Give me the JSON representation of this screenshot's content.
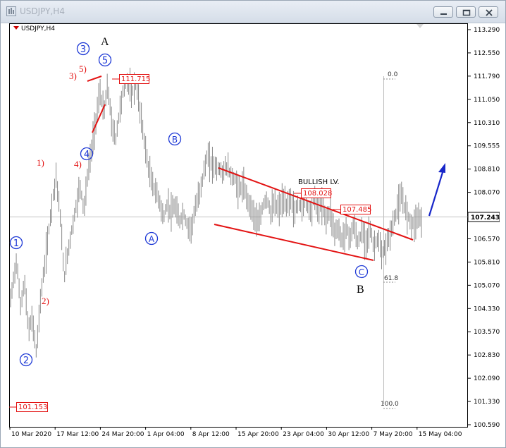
{
  "window": {
    "title": "USDJPY,H4"
  },
  "chart_data": {
    "type": "candlestick",
    "symbol_label": "USDJPY,H4",
    "current_price": "107.243",
    "y_ticks": [
      "113.290",
      "112.550",
      "111.790",
      "111.050",
      "110.310",
      "109.555",
      "108.810",
      "108.070",
      "107.320",
      "106.570",
      "105.810",
      "105.070",
      "104.330",
      "103.570",
      "102.830",
      "102.090",
      "101.330",
      "100.590"
    ],
    "ylim": [
      100.59,
      113.29
    ],
    "x_ticks": [
      "10 Mar 2020",
      "17 Mar 12:00",
      "24 Mar 20:00",
      "1 Apr 04:00",
      "8 Apr 12:00",
      "15 Apr 20:00",
      "23 Apr 04:00",
      "30 Apr 12:00",
      "7 May 20:00",
      "15 May 04:00"
    ],
    "price_marks": [
      "111.715",
      "108.028",
      "107.485",
      "101.153"
    ],
    "fib_levels": [
      "0.0",
      "61.8",
      "100.0"
    ],
    "annotations": {
      "wave_labels": [
        "A",
        "B"
      ],
      "bullish_label": "BULLISH LV.",
      "circled": [
        "1",
        "2",
        "3",
        "4",
        "5",
        "A",
        "B",
        "C"
      ],
      "minor": [
        "1)",
        "2)",
        "3)",
        "4)",
        "5)"
      ]
    },
    "price_path": [
      {
        "t": 0,
        "p": 104.6
      },
      {
        "t": 3,
        "p": 105.9
      },
      {
        "t": 5,
        "p": 104.4
      },
      {
        "t": 7,
        "p": 105.2
      },
      {
        "t": 9,
        "p": 103.6
      },
      {
        "t": 11,
        "p": 104.0
      },
      {
        "t": 13,
        "p": 102.9
      },
      {
        "t": 15,
        "p": 104.6
      },
      {
        "t": 17,
        "p": 105.6
      },
      {
        "t": 19,
        "p": 106.7
      },
      {
        "t": 21,
        "p": 107.8
      },
      {
        "t": 23,
        "p": 108.6
      },
      {
        "t": 25,
        "p": 107.3
      },
      {
        "t": 27,
        "p": 105.3
      },
      {
        "t": 29,
        "p": 106.2
      },
      {
        "t": 31,
        "p": 106.9
      },
      {
        "t": 33,
        "p": 107.6
      },
      {
        "t": 35,
        "p": 108.3
      },
      {
        "t": 37,
        "p": 107.5
      },
      {
        "t": 39,
        "p": 108.7
      },
      {
        "t": 41,
        "p": 109.5
      },
      {
        "t": 43,
        "p": 110.4
      },
      {
        "t": 45,
        "p": 111.3
      },
      {
        "t": 47,
        "p": 110.6
      },
      {
        "t": 49,
        "p": 111.5
      },
      {
        "t": 51,
        "p": 110.2
      },
      {
        "t": 53,
        "p": 109.8
      },
      {
        "t": 55,
        "p": 110.7
      },
      {
        "t": 57,
        "p": 111.4
      },
      {
        "t": 59,
        "p": 111.7
      },
      {
        "t": 61,
        "p": 111.2
      },
      {
        "t": 63,
        "p": 111.6
      },
      {
        "t": 65,
        "p": 110.8
      },
      {
        "t": 67,
        "p": 109.9
      },
      {
        "t": 69,
        "p": 109.0
      },
      {
        "t": 71,
        "p": 108.4
      },
      {
        "t": 73,
        "p": 108.1
      },
      {
        "t": 75,
        "p": 107.8
      },
      {
        "t": 77,
        "p": 107.2
      },
      {
        "t": 79,
        "p": 107.7
      },
      {
        "t": 81,
        "p": 107.4
      },
      {
        "t": 83,
        "p": 107.6
      },
      {
        "t": 85,
        "p": 107.1
      },
      {
        "t": 87,
        "p": 107.4
      },
      {
        "t": 89,
        "p": 107.0
      },
      {
        "t": 91,
        "p": 106.9
      },
      {
        "t": 93,
        "p": 107.5
      },
      {
        "t": 95,
        "p": 108.0
      },
      {
        "t": 97,
        "p": 108.6
      },
      {
        "t": 99,
        "p": 109.2
      },
      {
        "t": 101,
        "p": 109.0
      },
      {
        "t": 103,
        "p": 108.9
      },
      {
        "t": 105,
        "p": 108.8
      },
      {
        "t": 107,
        "p": 108.7
      },
      {
        "t": 109,
        "p": 108.9
      },
      {
        "t": 111,
        "p": 108.6
      },
      {
        "t": 113,
        "p": 108.5
      },
      {
        "t": 115,
        "p": 108.1
      },
      {
        "t": 117,
        "p": 108.3
      },
      {
        "t": 119,
        "p": 107.9
      },
      {
        "t": 121,
        "p": 107.6
      },
      {
        "t": 123,
        "p": 107.3
      },
      {
        "t": 125,
        "p": 107.0
      },
      {
        "t": 127,
        "p": 107.6
      },
      {
        "t": 129,
        "p": 107.9
      },
      {
        "t": 131,
        "p": 107.4
      },
      {
        "t": 133,
        "p": 107.7
      },
      {
        "t": 135,
        "p": 107.5
      },
      {
        "t": 137,
        "p": 107.8
      },
      {
        "t": 139,
        "p": 107.6
      },
      {
        "t": 141,
        "p": 107.9
      },
      {
        "t": 143,
        "p": 107.4
      },
      {
        "t": 145,
        "p": 107.7
      },
      {
        "t": 147,
        "p": 107.6
      },
      {
        "t": 149,
        "p": 107.8
      },
      {
        "t": 151,
        "p": 107.4
      },
      {
        "t": 153,
        "p": 107.9
      },
      {
        "t": 155,
        "p": 107.5
      },
      {
        "t": 157,
        "p": 107.7
      },
      {
        "t": 159,
        "p": 107.2
      },
      {
        "t": 161,
        "p": 107.5
      },
      {
        "t": 163,
        "p": 106.8
      },
      {
        "t": 165,
        "p": 106.9
      },
      {
        "t": 167,
        "p": 106.5
      },
      {
        "t": 169,
        "p": 106.9
      },
      {
        "t": 171,
        "p": 106.6
      },
      {
        "t": 173,
        "p": 107.0
      },
      {
        "t": 175,
        "p": 106.4
      },
      {
        "t": 177,
        "p": 106.8
      },
      {
        "t": 179,
        "p": 106.5
      },
      {
        "t": 181,
        "p": 106.9
      },
      {
        "t": 183,
        "p": 106.3
      },
      {
        "t": 185,
        "p": 106.6
      },
      {
        "t": 187,
        "p": 106.0
      },
      {
        "t": 189,
        "p": 106.3
      },
      {
        "t": 191,
        "p": 106.7
      },
      {
        "t": 193,
        "p": 107.1
      },
      {
        "t": 195,
        "p": 107.6
      },
      {
        "t": 197,
        "p": 107.9
      },
      {
        "t": 199,
        "p": 107.5
      },
      {
        "t": 201,
        "p": 107.2
      },
      {
        "t": 203,
        "p": 107.0
      },
      {
        "t": 205,
        "p": 107.3
      },
      {
        "t": 207,
        "p": 107.2
      }
    ]
  }
}
